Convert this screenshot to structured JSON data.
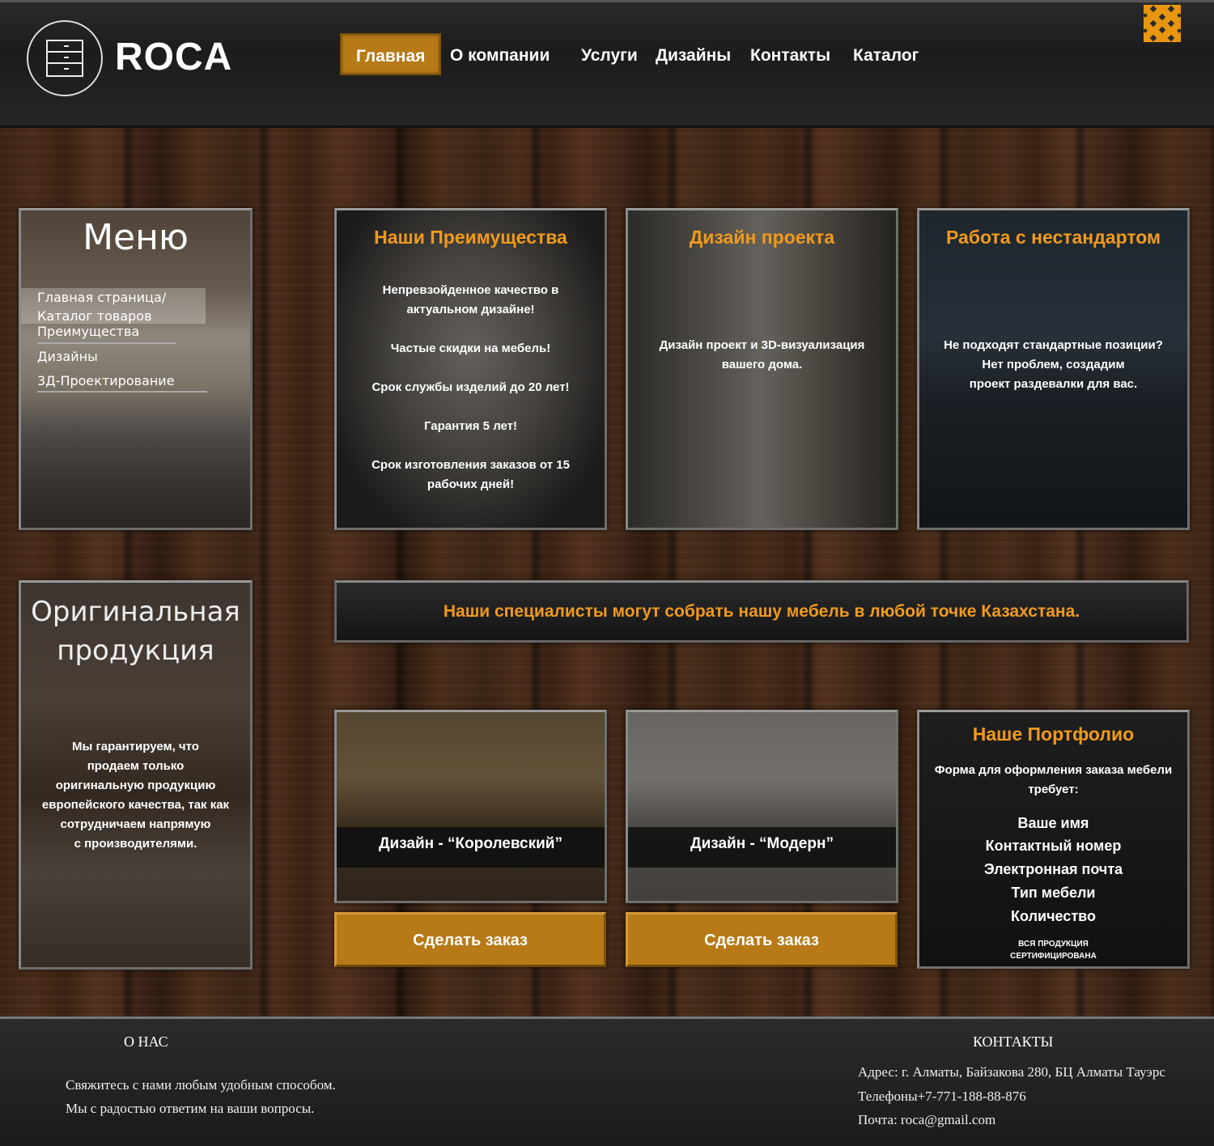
{
  "header": {
    "brand": "ROCA",
    "nav": [
      {
        "label": "Главная",
        "active": true
      },
      {
        "label": "О компании"
      },
      {
        "label": "Услуги"
      },
      {
        "label": "Дизайны"
      },
      {
        "label": "Контакты"
      },
      {
        "label": "Каталог"
      }
    ],
    "icons": {
      "logo": "dresser-icon",
      "corner": "ornament-icon"
    }
  },
  "menu": {
    "title": "Меню",
    "items": [
      "Главная страница/ Каталог товаров",
      "Преимущества",
      "Дизайны",
      "3Д-Проектирование"
    ]
  },
  "original": {
    "title_line1": "Оригинальная",
    "title_line2": "продукция",
    "text": [
      "Мы гарантируем, что",
      "продаем только",
      "оригинальную продукцию",
      "европейского качества, так как",
      "сотрудничаем напрямую",
      "с производителями."
    ]
  },
  "advantages": {
    "title": "Наши Преимущества",
    "items": [
      "Непревзойденное качество в",
      "актуальном дизайне!",
      "Частые скидки на мебель!",
      "Срок службы изделий до 20 лет!",
      "Гарантия 5 лет!",
      "Срок изготовления заказов от 15",
      "рабочих дней!"
    ]
  },
  "design_project": {
    "title": "Дизайн проекта",
    "text": [
      "Дизайн проект и 3D-визуализация",
      "вашего дома."
    ]
  },
  "custom": {
    "title": "Работа с нестандартом",
    "text": [
      "Не подходят стандартные позиции?",
      "Нет проблем, создадим",
      "проект раздевалки для вас."
    ]
  },
  "banner": {
    "text": "Наши специалисты могут собрать нашу мебель в любой точке Казахстана."
  },
  "designs": [
    {
      "label": "Дизайн - “Королевский”",
      "button": "Сделать заказ"
    },
    {
      "label": "Дизайн - “Модерн”",
      "button": "Сделать заказ"
    }
  ],
  "portfolio": {
    "title": "Наше Портфолио",
    "intro": [
      "Форма для оформления заказа мебели",
      "требует:"
    ],
    "fields": [
      "Ваше имя",
      "Контактный номер",
      "Электронная почта",
      "Тип мебели",
      "Количество"
    ],
    "note": [
      "ВСЯ ПРОДУКЦИЯ",
      "СЕРТИФИЦИРОВАНА"
    ]
  },
  "footer": {
    "about_heading": "О НАС",
    "about_text": [
      "Свяжитесь с нами любым удобным способом.",
      "Мы с радостью ответим на ваши вопросы."
    ],
    "contacts_heading": "КОНТАКТЫ",
    "address": "Адрес: г. Алматы, Байзакова 280, БЦ Алматы Тауэрс",
    "phone": "Телефоны+7-771-188-88-876",
    "email": "Почта: roca@gmail.com"
  },
  "colors": {
    "accent": "#f09a1c",
    "button": "#b77a16",
    "wood": "#3a2214",
    "panel_dark": "#1c1c1c"
  }
}
